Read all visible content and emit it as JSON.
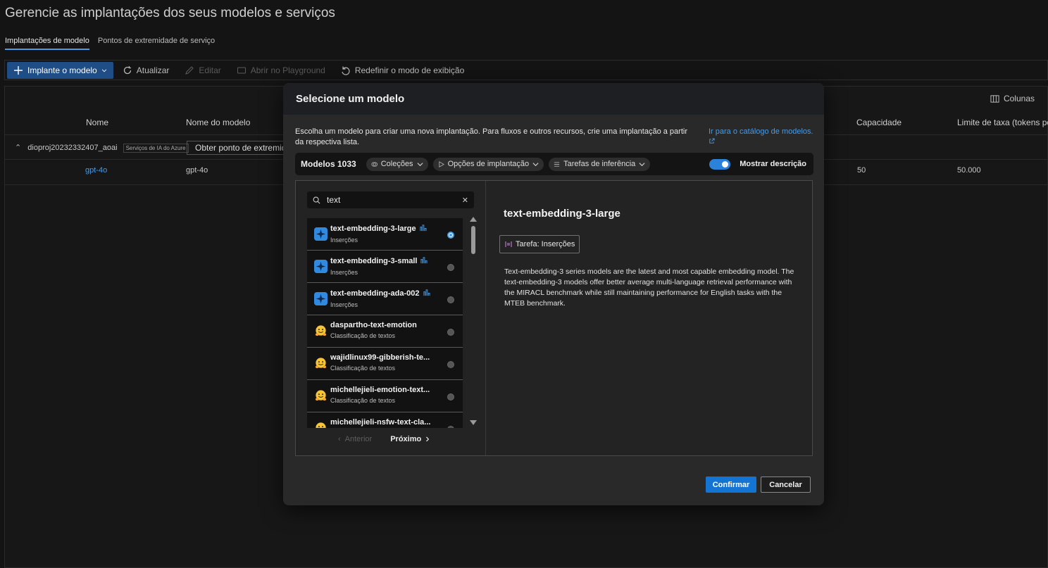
{
  "page": {
    "title": "Gerencie as implantações dos seus modelos e serviços"
  },
  "tabs": [
    "Implantações de modelo",
    "Pontos de extremidade de serviço"
  ],
  "toolbar": {
    "deploy": "Implante o modelo",
    "refresh": "Atualizar",
    "edit": "Editar",
    "open_playground": "Abrir no Playground",
    "reset_view": "Redefinir o modo de exibição"
  },
  "grid": {
    "columns_button": "Colunas",
    "headers": {
      "name": "Nome",
      "model_name": "Nome do modelo",
      "capacity": "Capacidade",
      "rate_limit": "Limite de taxa (tokens por m"
    },
    "group": {
      "name": "dioproj20232332407_aoai",
      "tag": "Serviços de IA do Azure",
      "endpoint_button": "Obter ponto de extremidade"
    },
    "row": {
      "name": "gpt-4o",
      "model_name": "gpt-4o",
      "capacity": "50",
      "rate_limit": "50.000"
    }
  },
  "modal": {
    "title": "Selecione um modelo",
    "intro": "Escolha um modelo para criar uma nova implantação. Para fluxos e outros recursos, crie uma implantação a partir da respectiva lista.",
    "catalog_link": "Ir para o catálogo de modelos.",
    "models_count": "Modelos 1033",
    "filters": [
      "Coleções",
      "Opções de implantação",
      "Tarefas de inferência"
    ],
    "show_description": "Mostrar descrição",
    "search_value": "text",
    "items": [
      {
        "name": "text-embedding-3-large",
        "sub": "Inserções",
        "icon": "azure-openai",
        "selected": true
      },
      {
        "name": "text-embedding-3-small",
        "sub": "Inserções",
        "icon": "azure-openai",
        "selected": false
      },
      {
        "name": "text-embedding-ada-002",
        "sub": "Inserções",
        "icon": "azure-openai",
        "selected": false
      },
      {
        "name": "daspartho-text-emotion",
        "sub": "Classificação de textos",
        "icon": "hugging-face",
        "selected": false
      },
      {
        "name": "wajidlinux99-gibberish-te...",
        "sub": "Classificação de textos",
        "icon": "hugging-face",
        "selected": false
      },
      {
        "name": "michellejieli-emotion-text...",
        "sub": "Classificação de textos",
        "icon": "hugging-face",
        "selected": false
      },
      {
        "name": "michellejieli-nsfw-text-cla...",
        "sub": "",
        "icon": "hugging-face",
        "selected": false
      }
    ],
    "pager": {
      "prev": "Anterior",
      "next": "Próximo"
    },
    "detail": {
      "title": "text-embedding-3-large",
      "task": "Tarefa: Inserções",
      "description": "Text-embedding-3 series models are the latest and most capable embedding model. The text-embedding-3 models offer better average multi-language retrieval performance with the MIRACL benchmark while still maintaining performance for English tasks with the MTEB benchmark."
    },
    "confirm": "Confirmar",
    "cancel": "Cancelar"
  },
  "colors": {
    "accent": "#1474d4",
    "link": "#4a9be4",
    "background": "#141414",
    "modal": "#292929"
  }
}
